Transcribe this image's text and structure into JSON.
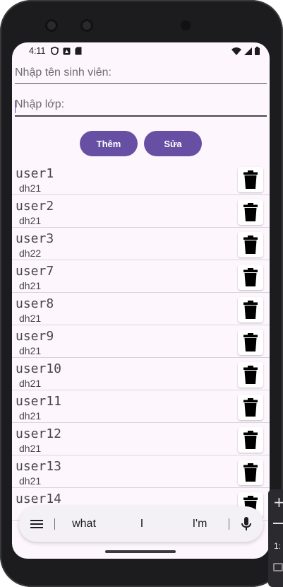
{
  "status_bar": {
    "time": "4:11"
  },
  "form": {
    "name_placeholder": "Nhập tên sinh viên:",
    "class_placeholder": "Nhập lớp:",
    "add_label": "Thêm",
    "edit_label": "Sửa"
  },
  "students": [
    {
      "name": "user1",
      "class": "dh21"
    },
    {
      "name": "user2",
      "class": "dh21"
    },
    {
      "name": "user3",
      "class": "dh22"
    },
    {
      "name": "user7",
      "class": "dh21"
    },
    {
      "name": "user8",
      "class": "dh21"
    },
    {
      "name": "user9",
      "class": "dh21"
    },
    {
      "name": "user10",
      "class": "dh21"
    },
    {
      "name": "user11",
      "class": "dh21"
    },
    {
      "name": "user12",
      "class": "dh21"
    },
    {
      "name": "user13",
      "class": "dh21"
    },
    {
      "name": "user14",
      "class": ""
    }
  ],
  "keyboard": {
    "suggestions": [
      "what",
      "I",
      "I'm"
    ]
  },
  "side_panel": {
    "ratio_label": "1:"
  },
  "colors": {
    "accent": "#6750a4",
    "screen_bg": "#fdf7fd"
  }
}
